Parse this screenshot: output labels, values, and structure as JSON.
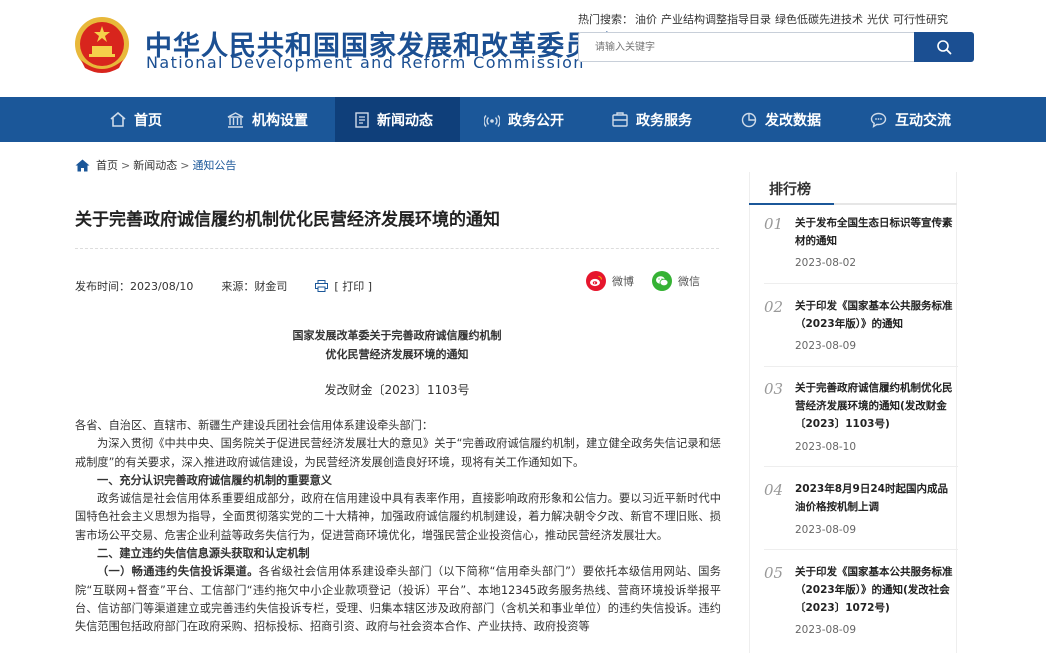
{
  "header": {
    "org_name_cn": "中华人民共和国国家发展和改革委员会",
    "org_name_en": "National Development and Reform Commission",
    "hot_search_label": "热门搜索：",
    "hot_search_items": [
      "油价",
      "产业结构调整指导目录",
      "绿色低碳先进技术",
      "光伏",
      "可行性研究"
    ],
    "search_placeholder": "请输入关键字",
    "search_icon": "search-icon",
    "emblem_icon": "national-emblem"
  },
  "nav": {
    "items": [
      {
        "label": "首页",
        "icon": "home-icon"
      },
      {
        "label": "机构设置",
        "icon": "building-icon"
      },
      {
        "label": "新闻动态",
        "icon": "news-icon"
      },
      {
        "label": "政务公开",
        "icon": "broadcast-icon"
      },
      {
        "label": "政务服务",
        "icon": "service-icon"
      },
      {
        "label": "发改数据",
        "icon": "chart-icon"
      },
      {
        "label": "互动交流",
        "icon": "chat-icon"
      }
    ],
    "active_index": 2,
    "colors": {
      "bar": "#1b5799",
      "active": "#0f3f7a"
    }
  },
  "breadcrumb": {
    "items": [
      "首页",
      "新闻动态",
      "通知公告"
    ],
    "separator": ">"
  },
  "article": {
    "title": "关于完善政府诚信履约机制优化民营经济发展环境的通知",
    "publish_time": "发布时间：2023/08/10",
    "source": "来源：财金司",
    "print_label": "[ 打印 ]",
    "share_weibo": "微博",
    "share_wechat": "微信",
    "doc_head_line1": "国家发展改革委关于完善政府诚信履约机制",
    "doc_head_line2": "优化民营经济发展环境的通知",
    "doc_number": "发改财金〔2023〕1103号",
    "p1": "各省、自治区、直辖市、新疆生产建设兵团社会信用体系建设牵头部门：",
    "p2": "为深入贯彻《中共中央、国务院关于促进民营经济发展壮大的意见》关于“完善政府诚信履约机制，建立健全政务失信记录和惩戒制度”的有关要求，深入推进政府诚信建设，为民营经济发展创造良好环境，现将有关工作通知如下。",
    "h1": "一、充分认识完善政府诚信履约机制的重要意义",
    "p3": "政务诚信是社会信用体系重要组成部分，政府在信用建设中具有表率作用，直接影响政府形象和公信力。要以习近平新时代中国特色社会主义思想为指导，全面贯彻落实党的二十大精神，加强政府诚信履约机制建设，着力解决朝令夕改、新官不理旧账、损害市场公平交易、危害企业利益等政务失信行为，促进营商环境优化，增强民营企业投资信心，推动民营经济发展壮大。",
    "h2": "二、建立违约失信信息源头获取和认定机制",
    "p4_lead": "（一）畅通违约失信投诉渠道。",
    "p4": "各省级社会信用体系建设牵头部门（以下简称“信用牵头部门”）要依托本级信用网站、国务院“互联网+督查”平台、工信部门“违约拖欠中小企业款项登记（投诉）平台”、本地12345政务服务热线、营商环境投诉举报平台、信访部门等渠道建立或完善违约失信投诉专栏，受理、归集本辖区涉及政府部门（含机关和事业单位）的违约失信投诉。违约失信范围包括政府部门在政府采购、招标投标、招商引资、政府与社会资本合作、产业扶持、政府投资等"
  },
  "sidebar": {
    "title": "排行榜",
    "items": [
      {
        "num": "01",
        "text": "关于发布全国生态日标识等宣传素材的通知",
        "date": "2023-08-02"
      },
      {
        "num": "02",
        "text": "关于印发《国家基本公共服务标准（2023年版）》的通知",
        "date": "2023-08-09"
      },
      {
        "num": "03",
        "text": "关于完善政府诚信履约机制优化民营经济发展环境的通知(发改财金〔2023〕1103号)",
        "date": "2023-08-10"
      },
      {
        "num": "04",
        "text": "2023年8月9日24时起国内成品油价格按机制上调",
        "date": "2023-08-09"
      },
      {
        "num": "05",
        "text": "关于印发《国家基本公共服务标准（2023年版）》的通知(发改社会〔2023〕1072号)",
        "date": "2023-08-09"
      }
    ]
  }
}
